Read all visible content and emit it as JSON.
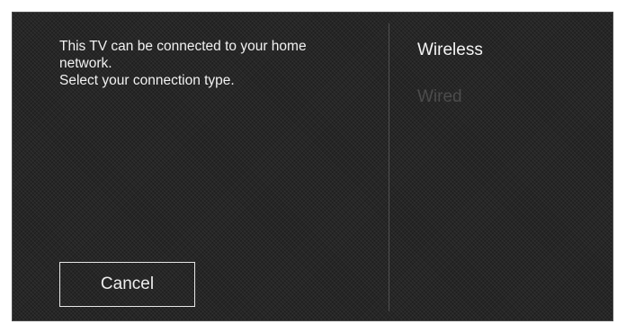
{
  "dialog": {
    "message_lines": [
      "This TV can be connected to your home",
      "network.",
      "Select your connection type."
    ],
    "options": [
      {
        "label": "Wireless",
        "state": "focused"
      },
      {
        "label": "Wired",
        "state": "dimmed"
      }
    ],
    "cancel_label": "Cancel"
  },
  "colors": {
    "background": "#262626",
    "text": "#f2f2f2",
    "dimmed_text": "#4c4c4c",
    "divider": "#505050"
  }
}
